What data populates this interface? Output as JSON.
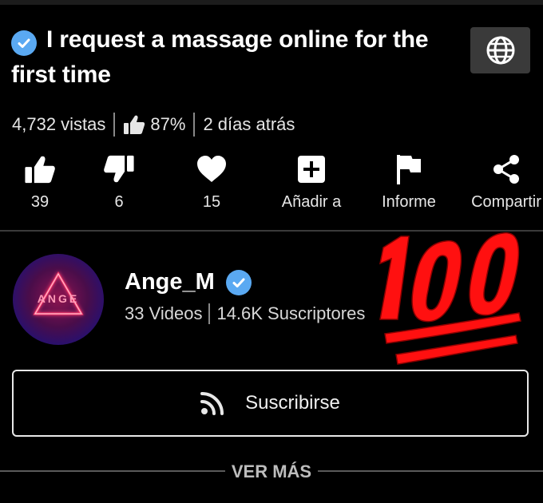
{
  "video": {
    "title": "I request a massage online for the first time",
    "views": "4,732 vistas",
    "rating": "87%",
    "age": "2 días atrás"
  },
  "actions": {
    "like": {
      "label": "39",
      "icon": "thumbs-up-icon"
    },
    "dislike": {
      "label": "6",
      "icon": "thumbs-down-icon"
    },
    "favorite": {
      "label": "15",
      "icon": "heart-icon"
    },
    "add": {
      "label": "Añadir a",
      "icon": "plus-box-icon"
    },
    "report": {
      "label": "Informe",
      "icon": "flag-icon"
    },
    "share": {
      "label": "Compartir",
      "icon": "share-icon"
    }
  },
  "channel": {
    "name": "Ange_M",
    "avatar_text": "ANGE",
    "videos": "33 Videos",
    "subscribers": "14.6K Suscriptores"
  },
  "subscribe": {
    "label": "Suscribirse",
    "icon": "rss-icon"
  },
  "more": {
    "label": "VER MÁS"
  },
  "overlay": {
    "emoji": "hundred-points-emoji",
    "color": "#ff1010"
  },
  "colors": {
    "background": "#000000",
    "verified": "#5aa9f2",
    "accent": "#ff2d6f"
  }
}
